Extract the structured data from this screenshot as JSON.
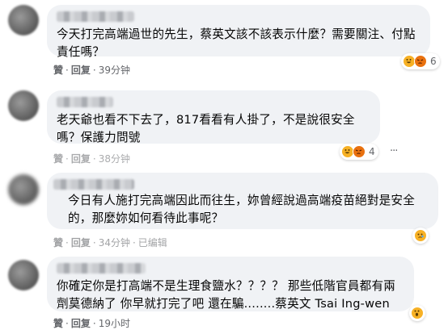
{
  "comments": [
    {
      "author": "",
      "text": "今天打完高端過世的先生，蔡英文該不該表示什麼？需要關注、付點責任嗎？",
      "like": "贊",
      "reply": "回复",
      "time": "39分钟",
      "reactions": [
        "haha-icon",
        "angry-icon"
      ],
      "reaction_count": "6"
    },
    {
      "author": "",
      "text": "老天爺也看不下去了，817看看有人掛了，不是說很安全嗎？保護力問號",
      "like": "贊",
      "reply": "回复",
      "time": "38分钟",
      "reactions": [
        "haha-icon",
        "angry-icon"
      ],
      "reaction_count": "4"
    },
    {
      "author": "",
      "text": "今日有人施打完高端因此而往生，妳曾經說過高端疫苗絕對是安全的，那麼妳如何看待此事呢？",
      "like": "贊",
      "reply": "回复",
      "time": "34分钟",
      "edited": "已编辑",
      "reactions": [
        "sad-icon"
      ],
      "reaction_count": ""
    },
    {
      "author": "",
      "text": "你確定你是打高端不是生理食鹽水？？？？ 那些低階官員都有兩劑莫德納了 你早就打完了吧 還在騙........蔡英文 Tsai Ing-wen",
      "like": "贊",
      "reply": "回复",
      "time": "19小时",
      "reactions": [
        "wow-icon"
      ],
      "reaction_count": ""
    }
  ],
  "colors": {
    "bubble": "#f0f2f5",
    "text": "#050505",
    "meta": "#65676b",
    "haha": "#f7b125",
    "angry": "#e9710f"
  }
}
